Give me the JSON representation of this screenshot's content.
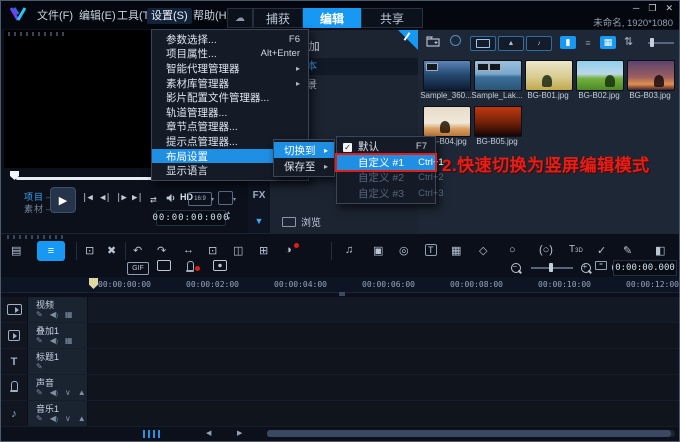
{
  "colors": {
    "accent_blue": "#1798f2",
    "menu_highlight_blue": "#1e8fe3",
    "annotation_red": "#e51c15",
    "selected_text_blue": "#3fa9f5"
  },
  "titlebar": {
    "menus": [
      {
        "label": "文件(F)"
      },
      {
        "label": "编辑(E)"
      },
      {
        "label": "工具(T)"
      },
      {
        "label": "设置(S)"
      },
      {
        "label": "帮助(H)"
      }
    ],
    "tabs": [
      {
        "label": "捕获"
      },
      {
        "label": "编辑",
        "active": true
      },
      {
        "label": "共享"
      }
    ],
    "project_info": "未命名, 1920*1080",
    "window_controls": {
      "minimize": "─",
      "maximize": "❒",
      "close": "✕"
    }
  },
  "settings_menu": {
    "items": [
      {
        "label": "参数选择...",
        "shortcut": "F6"
      },
      {
        "label": "项目属性...",
        "shortcut": "Alt+Enter"
      },
      {
        "label": "智能代理管理器"
      },
      {
        "label": "素材库管理器"
      },
      {
        "label": "影片配置文件管理器..."
      },
      {
        "label": "轨道管理器..."
      },
      {
        "label": "章节点管理器..."
      },
      {
        "label": "提示点管理器..."
      },
      {
        "label": "布局设置",
        "highlighted": true
      },
      {
        "label": "显示语言"
      }
    ]
  },
  "layout_submenu": {
    "items": [
      {
        "label": "切换到",
        "highlighted": true
      },
      {
        "label": "保存至"
      }
    ]
  },
  "switch_submenu": {
    "items": [
      {
        "label": "默认",
        "shortcut": "F7",
        "checked": true
      },
      {
        "label": "自定义 #1",
        "shortcut": "Ctrl+1",
        "highlighted": true
      },
      {
        "label": "自定义 #2",
        "shortcut": "Ctrl+2",
        "disabled": true
      },
      {
        "label": "自定义 #3",
        "shortcut": "Ctrl+3",
        "disabled": true
      }
    ]
  },
  "annotation": {
    "text": "2.快速切换为竖屏编辑模式"
  },
  "library": {
    "add_label": "添加",
    "categories": [
      {
        "label": "样本",
        "selected": true
      },
      {
        "label": "背景"
      }
    ],
    "browse_label": "浏览",
    "thumbnails": [
      {
        "name": "Sample_360..."
      },
      {
        "name": "Sample_Lak..."
      },
      {
        "name": "BG-B01.jpg"
      },
      {
        "name": "BG-B02.jpg"
      },
      {
        "name": "BG-B03.jpg"
      },
      {
        "name": "BG-B04.jpg"
      },
      {
        "name": "BG-B05.jpg"
      }
    ]
  },
  "player": {
    "project_label": "项目",
    "clip_label": "素材",
    "hd_label": "HD",
    "aspect_label": "16:9",
    "timecode": "00:00:00:000"
  },
  "side_strip": {
    "fx_label": "FX"
  },
  "toolbar": {
    "gif_label": "GIF",
    "timecode": "0:00:00.000"
  },
  "timeline": {
    "ruler_labels": [
      "00:00:00:00",
      "00:00:02:00",
      "00:00:04:00",
      "00:00:06:00",
      "00:00:08:00",
      "00:00:10:00",
      "00:00:12:00"
    ],
    "tracks": [
      {
        "name": "视频"
      },
      {
        "name": "叠加1"
      },
      {
        "name": "标题1"
      },
      {
        "name": "声音"
      },
      {
        "name": "音乐1"
      }
    ]
  },
  "icons": {
    "submenu_arrow": "▸",
    "dropdown_arrow": "▾",
    "check": "✔",
    "play": "▶",
    "go_start": "|◀",
    "prev_frame": "◀|",
    "next_frame": "|▶",
    "go_end": "▶|",
    "loop": "⇄",
    "undo": "↶",
    "redo": "↷",
    "scissors": "✂",
    "bracket_open": "[",
    "bracket_close": "]",
    "pencil": "✎",
    "grid": "▦",
    "music_note": "♪",
    "double_note": "♫",
    "down_arrow": "▼",
    "left_arrow": "◀",
    "right_arrow": "▶",
    "wave": "∨",
    "duck": "▲",
    "cloud": "☁",
    "film": "▤",
    "lines": "≡",
    "copy": "⊡",
    "multitool": "✖",
    "ripple": "↔",
    "enlarge": "⊡",
    "splitview": "◫",
    "trim": "⊞",
    "colorwheel": "◑",
    "template": "▣",
    "roll": "◎",
    "title_t": "T",
    "tracking": "◇",
    "speech": "○",
    "checkbox": "✓",
    "adjust": "◧",
    "sort": "⇅",
    "mountain": "▲",
    "list": "≡",
    "panel_view": "▮"
  }
}
